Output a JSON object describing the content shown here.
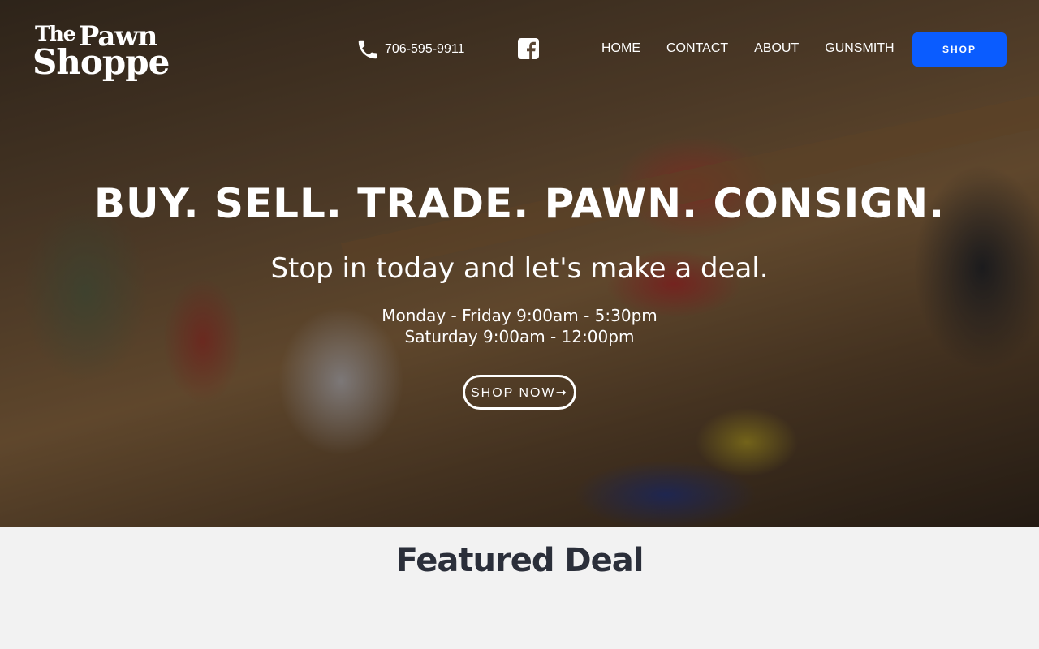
{
  "brand": {
    "logo_line1": "Pawn",
    "logo_prefix": "The",
    "logo_line2": "Shoppe"
  },
  "header": {
    "phone": "706-595-9911",
    "nav": [
      "HOME",
      "CONTACT",
      "ABOUT",
      "GUNSMITH"
    ],
    "shop_label": "SHOP",
    "accent_color": "#0a5cff"
  },
  "hero": {
    "headline": "BUY. SELL. TRADE. PAWN. CONSIGN.",
    "tagline": "Stop in today and let's make a deal.",
    "hours_weekday": "Monday - Friday 9:00am - 5:30pm",
    "hours_saturday": "Saturday 9:00am - 12:00pm",
    "cta_label": "SHOP NOW➞"
  },
  "featured": {
    "title": "Featured Deal"
  },
  "icons": {
    "phone": "phone-icon",
    "social": "facebook-icon"
  }
}
